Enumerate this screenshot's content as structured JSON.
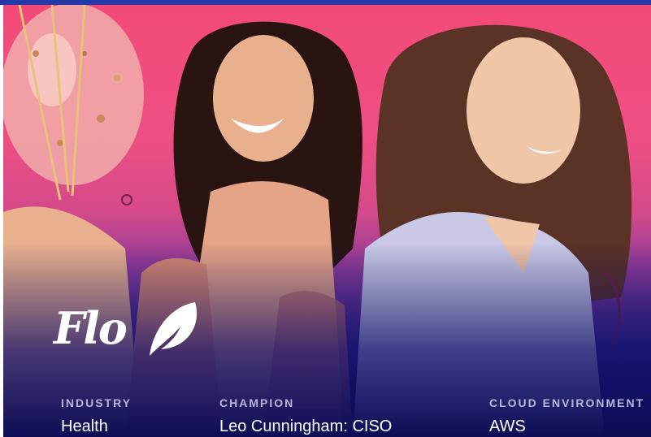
{
  "brand": {
    "logo_text": "Flo"
  },
  "facts": [
    {
      "label": "INDUSTRY",
      "value": "Health"
    },
    {
      "label": "CHAMPION",
      "value": "Leo Cunningham: CISO"
    },
    {
      "label": "CLOUD ENVIRONMENT",
      "value": "AWS"
    }
  ],
  "colors": {
    "accent_bar": "#2438a8",
    "hero_top": "#f24a78",
    "hero_bottom": "#0d0d55",
    "label": "#b9b6d9"
  }
}
